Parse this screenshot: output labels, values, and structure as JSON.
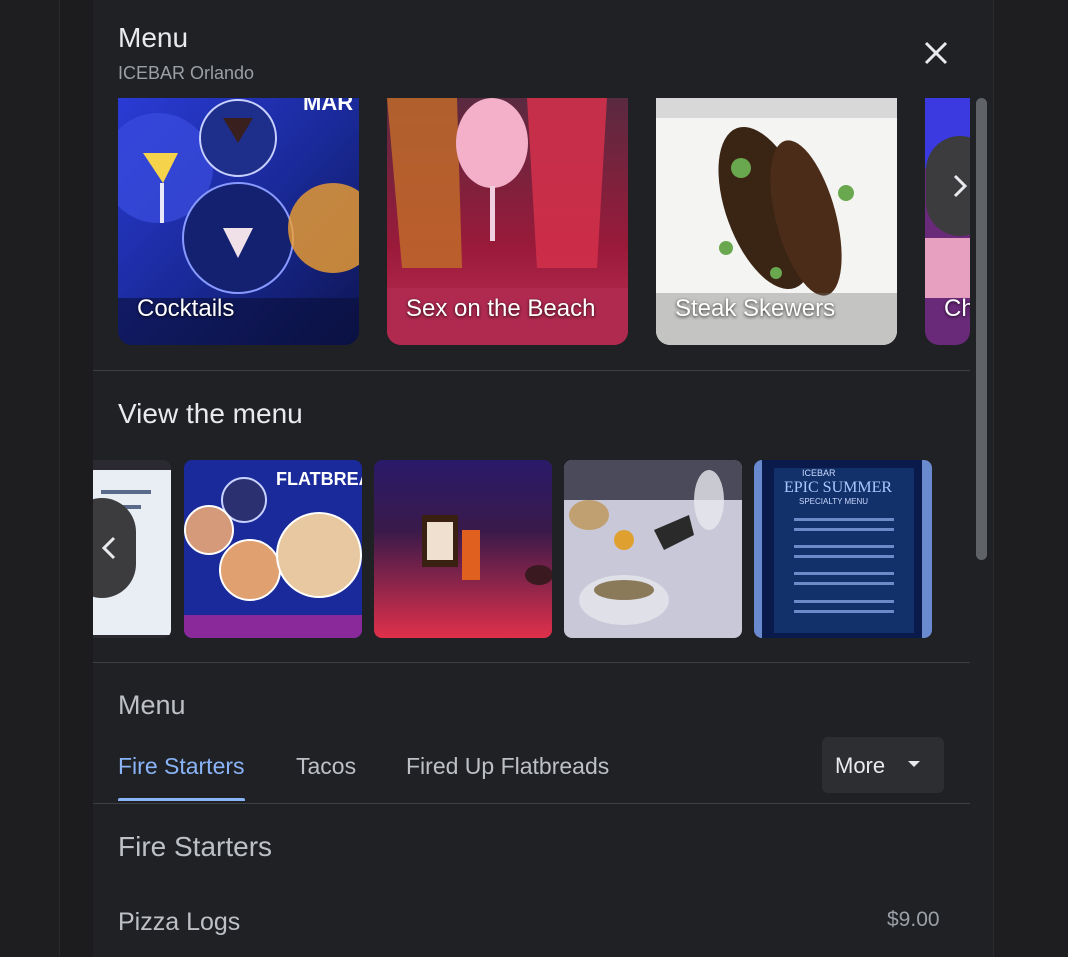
{
  "header": {
    "title": "Menu",
    "subtitle": "ICEBAR Orlando",
    "close_icon": "close-icon"
  },
  "popular_dishes": [
    {
      "label": "Cocktails"
    },
    {
      "label": "Sex on the Beach"
    },
    {
      "label": "Steak Skewers"
    },
    {
      "label": "Ch"
    }
  ],
  "view_menu": {
    "heading": "View the menu"
  },
  "menu_section": {
    "label": "Menu",
    "tabs": [
      {
        "label": "Fire Starters",
        "active": true
      },
      {
        "label": "Tacos",
        "active": false
      },
      {
        "label": "Fired Up Flatbreads",
        "active": false
      }
    ],
    "more_label": "More"
  },
  "category": {
    "title": "Fire Starters",
    "items": [
      {
        "name": "Pizza Logs",
        "price": "$9.00"
      }
    ]
  },
  "colors": {
    "panel_bg": "#202124",
    "accent": "#8ab4f8",
    "text": "#e8eaed",
    "muted": "#9aa0a6"
  }
}
